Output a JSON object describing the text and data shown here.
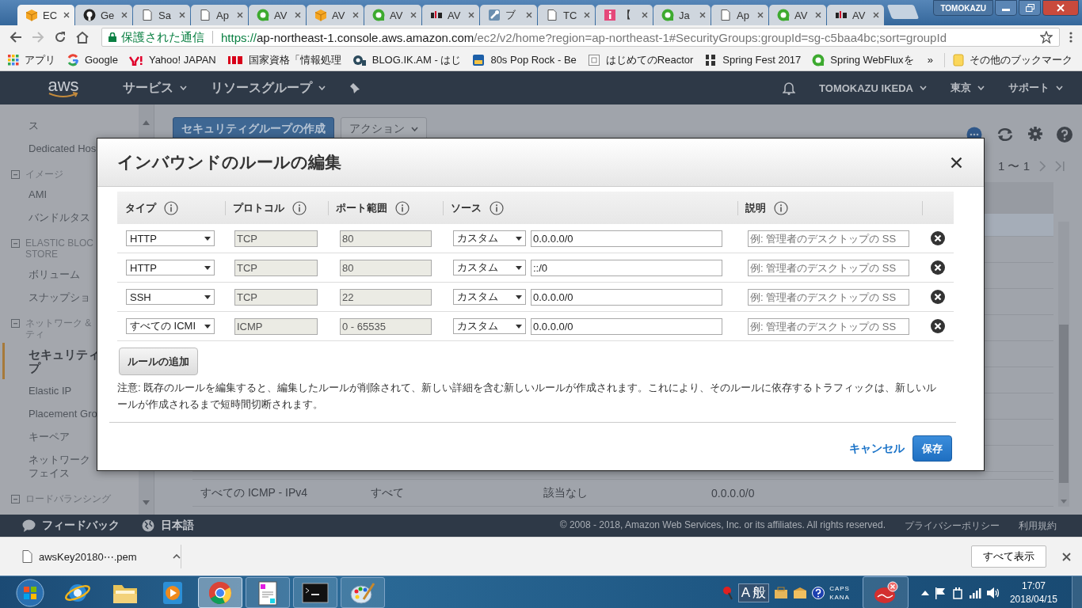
{
  "browser": {
    "tabs": [
      {
        "title": "EC",
        "selected": true
      },
      {
        "title": "Ge",
        "selected": false
      },
      {
        "title": "Sa",
        "selected": false
      },
      {
        "title": "Ap",
        "selected": false
      },
      {
        "title": "AV",
        "selected": false
      },
      {
        "title": "AV",
        "selected": false
      },
      {
        "title": "AV",
        "selected": false
      },
      {
        "title": "AV",
        "selected": false
      },
      {
        "title": "ブ",
        "selected": false
      },
      {
        "title": "TC",
        "selected": false
      },
      {
        "title": "【",
        "selected": false
      },
      {
        "title": "Ja",
        "selected": false
      },
      {
        "title": "Ap",
        "selected": false
      },
      {
        "title": "AV",
        "selected": false
      },
      {
        "title": "AV",
        "selected": false
      }
    ],
    "profile": "TOMOKAZU",
    "address": {
      "security_label": "保護された通信",
      "url_scheme": "https://",
      "url_host": "ap-northeast-1.console.aws.amazon.com",
      "url_path": "/ec2/v2/home?region=ap-northeast-1#SecurityGroups:groupId=sg-c5baa4bc;sort=groupId"
    },
    "bookmarks": [
      {
        "label": "アプリ"
      },
      {
        "label": "Google"
      },
      {
        "label": "Yahoo! JAPAN"
      },
      {
        "label": "国家資格「情報処理"
      },
      {
        "label": "BLOG.IK.AM - はじ"
      },
      {
        "label": "80s Pop Rock - Be"
      },
      {
        "label": "はじめてのReactor"
      },
      {
        "label": "Spring Fest 2017"
      },
      {
        "label": "Spring WebFluxを"
      }
    ],
    "bookmarks_overflow": "»",
    "other_bookmarks": "その他のブックマーク"
  },
  "console": {
    "logo": "aws",
    "nav": [
      {
        "label": "サービス"
      },
      {
        "label": "リソースグループ"
      }
    ],
    "account": "TOMOKAZU IKEDA",
    "region": "東京",
    "support": "サポート",
    "sidebar": [
      {
        "kind": "item",
        "lines": [
          "ス"
        ],
        "selected": false
      },
      {
        "kind": "item",
        "lines": [
          "Dedicated Hos"
        ],
        "selected": false
      },
      {
        "kind": "section",
        "lines": [
          "イメージ"
        ]
      },
      {
        "kind": "item",
        "lines": [
          "AMI"
        ],
        "selected": false
      },
      {
        "kind": "item",
        "lines": [
          "バンドルタス"
        ],
        "selected": false
      },
      {
        "kind": "section",
        "lines": [
          "ELASTIC BLOC",
          "STORE"
        ]
      },
      {
        "kind": "item",
        "lines": [
          "ボリューム"
        ],
        "selected": false
      },
      {
        "kind": "item",
        "lines": [
          "スナップショ"
        ],
        "selected": false
      },
      {
        "kind": "section",
        "lines": [
          "ネットワーク &",
          "ティ"
        ]
      },
      {
        "kind": "item",
        "lines": [
          "セキュリティ",
          "プ"
        ],
        "selected": true
      },
      {
        "kind": "item",
        "lines": [
          "Elastic IP"
        ],
        "selected": false
      },
      {
        "kind": "item",
        "lines": [
          "Placement Gro"
        ],
        "selected": false
      },
      {
        "kind": "item",
        "lines": [
          "キーペア"
        ],
        "selected": false
      },
      {
        "kind": "item",
        "lines": [
          "ネットワーク",
          "フェイス"
        ],
        "selected": false
      },
      {
        "kind": "section",
        "lines": [
          "ロードバランシング"
        ]
      }
    ],
    "create_button": "セキュリティグループの作成",
    "actions_button": "アクション",
    "pagination": "1 〜 1",
    "table_rows": [
      [
        "すべての ICMP - IPv4",
        "すべて",
        "該当なし",
        "0.0.0.0/0"
      ]
    ],
    "footer": {
      "feedback": "フィードバック",
      "language": "日本語",
      "copyright": "© 2008 - 2018, Amazon Web Services, Inc. or its affiliates. All rights reserved.",
      "links": [
        "プライバシーポリシー",
        "利用規約"
      ]
    }
  },
  "dialog": {
    "title": "インバウンドのルールの編集",
    "columns": [
      "タイプ",
      "プロトコル",
      "ポート範囲",
      "ソース",
      "説明"
    ],
    "rules": [
      {
        "type": "HTTP",
        "protocol": "TCP",
        "port_range": "80",
        "source_type": "カスタム",
        "source": "0.0.0.0/0",
        "fixed": true,
        "description": {
          "placeholder": "例: 管理者のデスクトップの SS"
        }
      },
      {
        "type": "HTTP",
        "protocol": "TCP",
        "port_range": "80",
        "source_type": "カスタム",
        "source": "::/0",
        "fixed": true,
        "description": {
          "placeholder": "例: 管理者のデスクトップの SS"
        }
      },
      {
        "type": "SSH",
        "protocol": "TCP",
        "port_range": "22",
        "source_type": "カスタム",
        "source": "0.0.0.0/0",
        "fixed": true,
        "description": {
          "placeholder": "例: 管理者のデスクトップの SS"
        }
      },
      {
        "type": "すべての ICMI",
        "protocol": "ICMP",
        "port_range": "0 - 65535",
        "source_type": "カスタム",
        "source": "0.0.0.0/0",
        "fixed": true,
        "description": {
          "placeholder": "例: 管理者のデスクトップの SS"
        }
      }
    ],
    "add_button": "ルールの追加",
    "note": "注意: 既存のルールを編集すると、編集したルールが削除されて、新しい詳細を含む新しいルールが作成されます。これにより、そのルールに依存するトラフィックは、新しいルールが作成されるまで短時間切断されます。",
    "cancel": "キャンセル",
    "save": "保存"
  },
  "downloads": {
    "file": "awsKey20180⋯.pem",
    "show_all": "すべて表示"
  },
  "taskbar": {
    "apps": [
      {
        "kind": "ie",
        "open": false,
        "selected": false
      },
      {
        "kind": "folder",
        "open": false,
        "selected": false
      },
      {
        "kind": "media",
        "open": false,
        "selected": false
      },
      {
        "kind": "chrome",
        "open": true,
        "selected": true
      },
      {
        "kind": "notepad",
        "open": true,
        "selected": false
      },
      {
        "kind": "cmd",
        "open": true,
        "selected": false
      },
      {
        "kind": "paint",
        "open": true,
        "selected": false
      }
    ],
    "ime": [
      "A",
      "般"
    ],
    "caps": "CAPS",
    "kana": "KANA",
    "time": "17:07",
    "date": "2018/04/15"
  }
}
